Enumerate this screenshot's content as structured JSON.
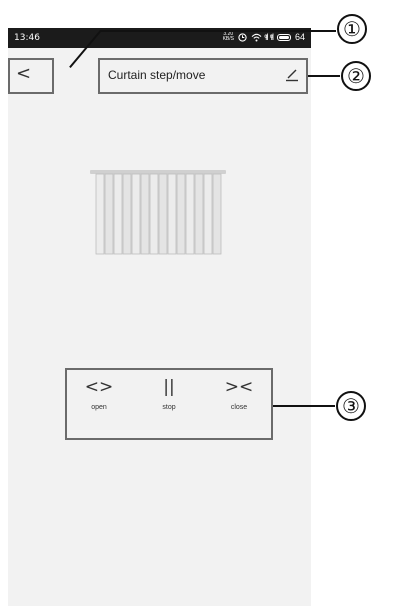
{
  "status_bar": {
    "time": "13:46",
    "speed_top": "3.20",
    "speed_bottom": "KB/S",
    "signal1": "ͦıl",
    "signal2": "ͦıl",
    "battery": "64"
  },
  "header": {
    "back_glyph": "<",
    "title": "Curtain step/move"
  },
  "controls": {
    "open": {
      "glyph": "<>",
      "label": "open"
    },
    "stop": {
      "glyph": "||",
      "label": "stop"
    },
    "close": {
      "glyph": "><",
      "label": "close"
    }
  },
  "callouts": [
    "①",
    "②",
    "③"
  ]
}
